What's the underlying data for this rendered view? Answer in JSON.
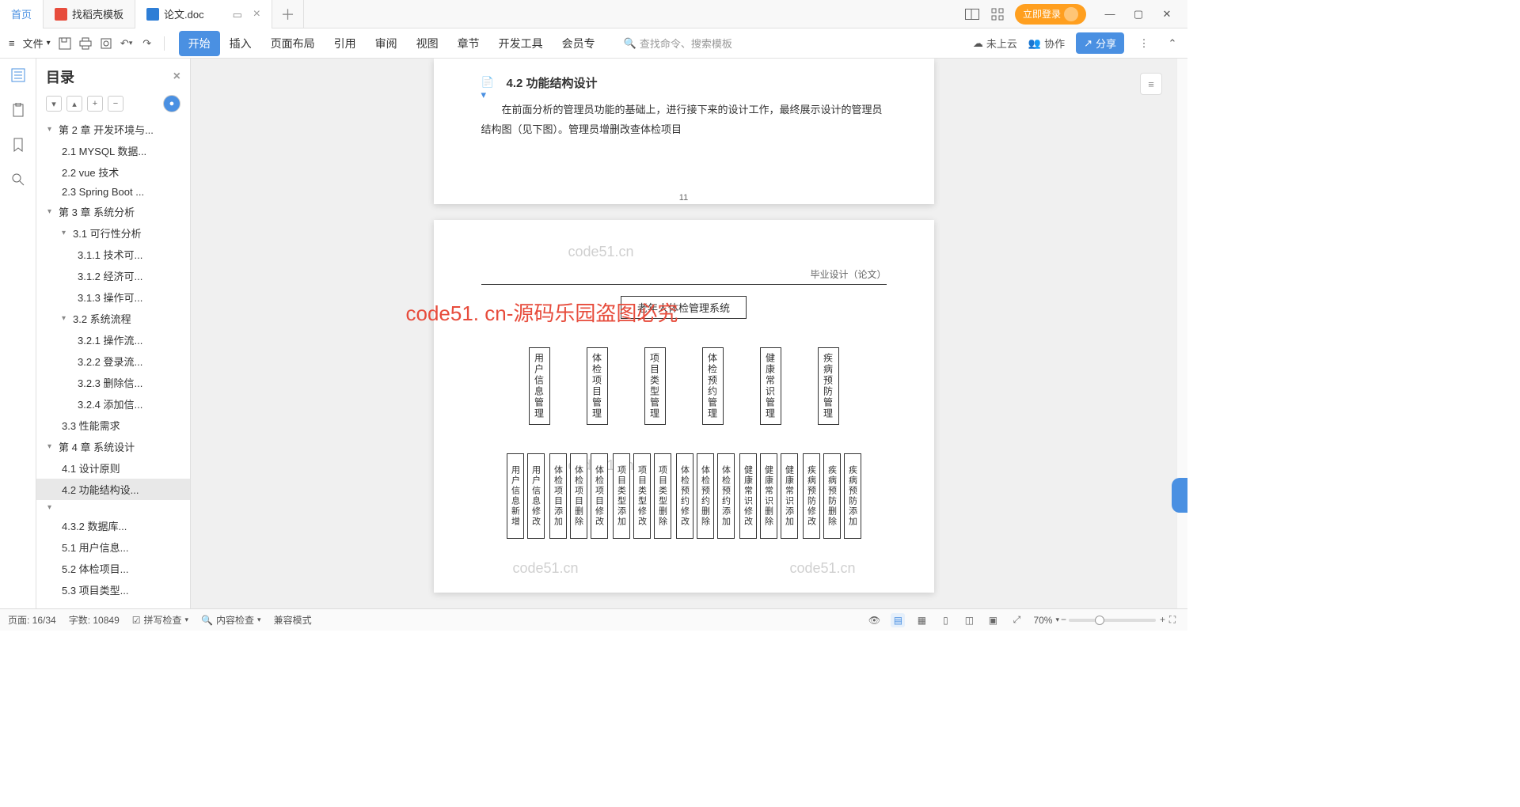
{
  "tabs": {
    "home": "首页",
    "t1": "找稻壳模板",
    "t2": "论文.doc",
    "add": "＋"
  },
  "login_label": "立即登录",
  "toolbar": {
    "file": "文件",
    "ribbon": [
      "开始",
      "插入",
      "页面布局",
      "引用",
      "审阅",
      "视图",
      "章节",
      "开发工具",
      "会员专"
    ],
    "search_placeholder": "查找命令、搜索模板",
    "cloud": "未上云",
    "collab": "协作",
    "share": "分享"
  },
  "outline": {
    "title": "目录",
    "items": [
      {
        "lvl": 1,
        "chev": "▾",
        "text": "第 2 章  开发环境与..."
      },
      {
        "lvl": 2,
        "text": "2.1 MYSQL 数据..."
      },
      {
        "lvl": 2,
        "text": "2.2 vue 技术"
      },
      {
        "lvl": 2,
        "text": "2.3 Spring Boot ..."
      },
      {
        "lvl": 1,
        "chev": "▾",
        "text": "第 3 章  系统分析"
      },
      {
        "lvl": 2,
        "chev": "▾",
        "text": "3.1 可行性分析"
      },
      {
        "lvl": 3,
        "text": "3.1.1 技术可..."
      },
      {
        "lvl": 3,
        "text": "3.1.2 经济可..."
      },
      {
        "lvl": 3,
        "text": "3.1.3 操作可..."
      },
      {
        "lvl": 2,
        "chev": "▾",
        "text": "3.2 系统流程"
      },
      {
        "lvl": 3,
        "text": "3.2.1 操作流..."
      },
      {
        "lvl": 3,
        "text": "3.2.2 登录流..."
      },
      {
        "lvl": 3,
        "text": "3.2.3 删除信..."
      },
      {
        "lvl": 3,
        "text": "3.2.4 添加信..."
      },
      {
        "lvl": 2,
        "text": "3.3 性能需求"
      },
      {
        "lvl": 1,
        "chev": "▾",
        "text": "第 4 章  系统设计"
      },
      {
        "lvl": 2,
        "text": "4.1 设计原则"
      },
      {
        "lvl": 2,
        "text": "4.2 功能结构设...",
        "selected": true
      },
      {
        "lvl": 1,
        "chev": "▾",
        "text": ""
      },
      {
        "lvl": 2,
        "text": "4.3.2 数据库..."
      },
      {
        "lvl": 2,
        "text": "5.1 用户信息..."
      },
      {
        "lvl": 2,
        "text": "5.2 体检项目..."
      },
      {
        "lvl": 2,
        "text": "5.3 项目类型..."
      }
    ]
  },
  "doc": {
    "heading": "4.2  功能结构设计",
    "body": "在前面分析的管理员功能的基础上，进行接下来的设计工作，最终展示设计的管理员结构图（见下图）。管理员增删改查体检项目",
    "pagenum": "11",
    "wm": "code51.cn",
    "wm_red": "code51. cn-源码乐园盗图必究",
    "thesis_header": "毕业设计（论文）",
    "org_root": "老年人体检管理系统",
    "org_l1": [
      "用户信息管理",
      "体检项目管理",
      "项目类型管理",
      "体检预约管理",
      "健康常识管理",
      "疾病预防管理"
    ],
    "org_l2": [
      [
        "用户信息新增",
        "用户信息修改"
      ],
      [
        "体检项目添加",
        "体检项目删除",
        "体检项目修改"
      ],
      [
        "项目类型添加",
        "项目类型修改",
        "项目类型删除"
      ],
      [
        "体检预约修改",
        "体检预约删除",
        "体检预约添加"
      ],
      [
        "健康常识修改",
        "健康常识删除",
        "健康常识添加"
      ],
      [
        "疾病预防修改",
        "疾病预防删除",
        "疾病预防添加"
      ]
    ]
  },
  "status": {
    "page": "页面: 16/34",
    "words": "字数: 10849",
    "spell": "拼写检查",
    "content": "内容检查",
    "compat": "兼容模式",
    "zoom": "70%"
  }
}
